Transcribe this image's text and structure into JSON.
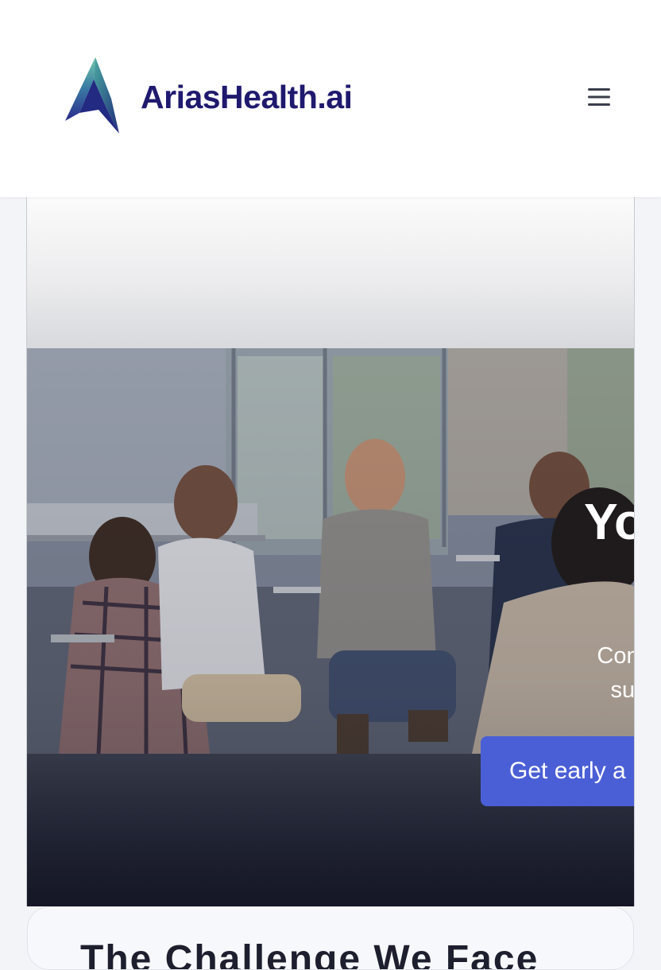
{
  "header": {
    "brand_name": "AriasHealth.ai",
    "logo_icon": "peak-a-logo-icon",
    "menu_icon": "hamburger-menu-icon"
  },
  "hero": {
    "title": "Yo",
    "subtitle_line1": "Confidential",
    "subtitle_line2": "supp",
    "cta_label": "Get early a",
    "image_description_icon": "support-group-photo"
  },
  "section": {
    "title": "The Challenge We Face"
  },
  "colors": {
    "brand_text": "#1f1a6e",
    "cta_background": "#4a5fd6",
    "page_background": "#f3f4f8"
  }
}
